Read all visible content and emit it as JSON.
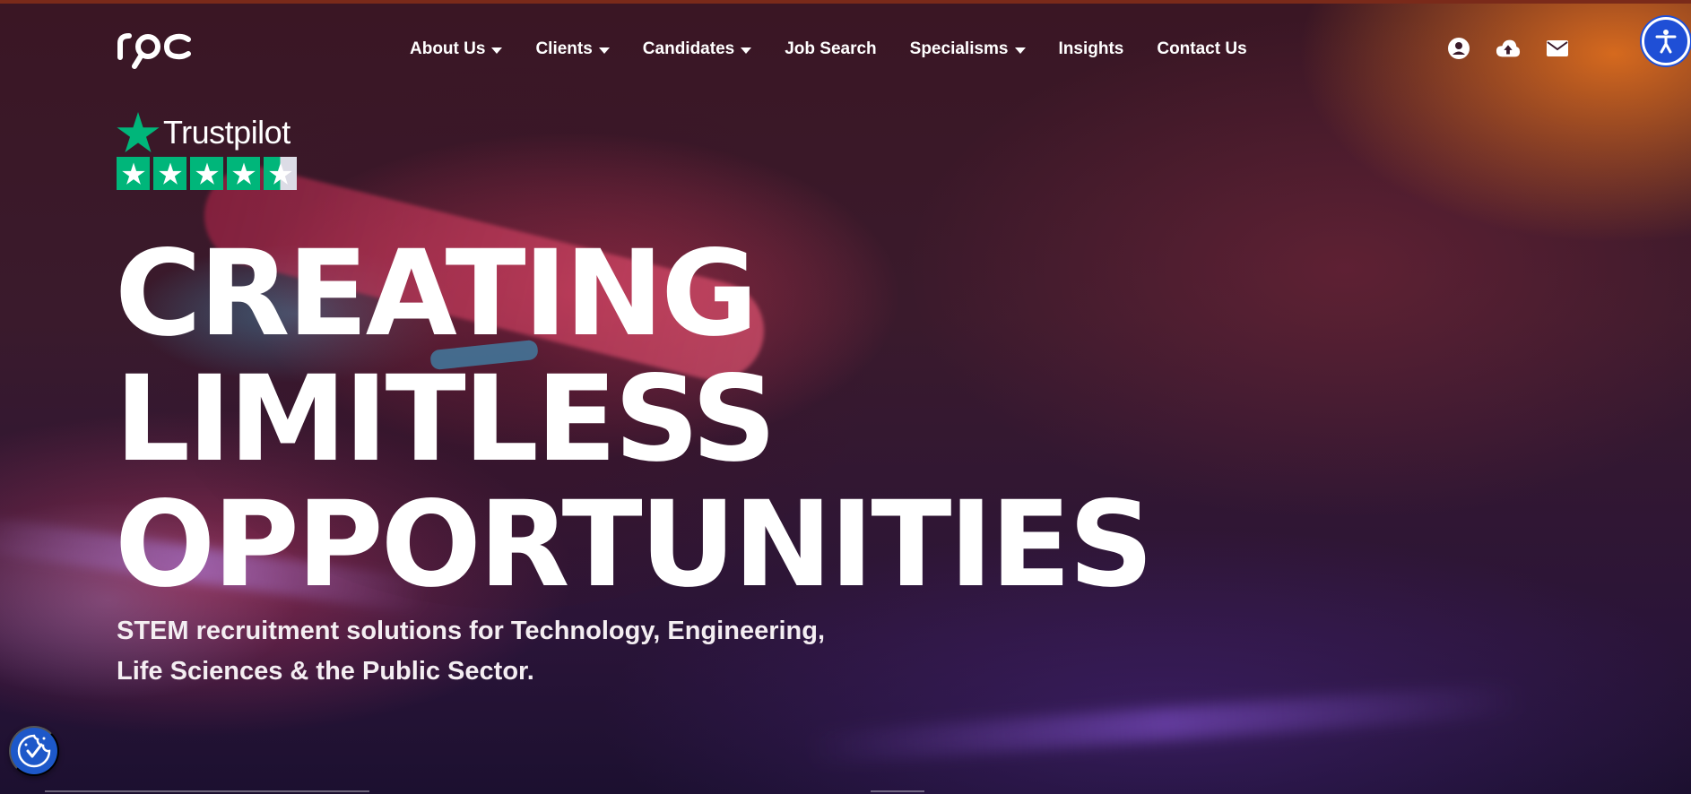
{
  "brand": {
    "logo_text": "rpc"
  },
  "nav": {
    "items": [
      {
        "label": "About Us",
        "has_dropdown": true
      },
      {
        "label": "Clients",
        "has_dropdown": true
      },
      {
        "label": "Candidates",
        "has_dropdown": true
      },
      {
        "label": "Job Search",
        "has_dropdown": false
      },
      {
        "label": "Specialisms",
        "has_dropdown": true
      },
      {
        "label": "Insights",
        "has_dropdown": false
      },
      {
        "label": "Contact Us",
        "has_dropdown": false
      }
    ],
    "icons": [
      "user-icon",
      "cloud-upload-icon",
      "envelope-icon"
    ]
  },
  "trustpilot": {
    "brand": "Trustpilot",
    "rating_stars": 4.5,
    "star_color": "#00b67a"
  },
  "hero": {
    "headline_lines": [
      "CREATING",
      "LIMITLESS",
      "OPPORTUNITIES"
    ],
    "subtitle_line1": "STEM recruitment solutions for Technology, Engineering,",
    "subtitle_line2": "Life Sciences & the Public Sector."
  },
  "widgets": {
    "accessibility_icon": "accessibility-icon",
    "cookie_icon": "cookie-consent-icon",
    "accent_color": "#1f4fd6"
  }
}
